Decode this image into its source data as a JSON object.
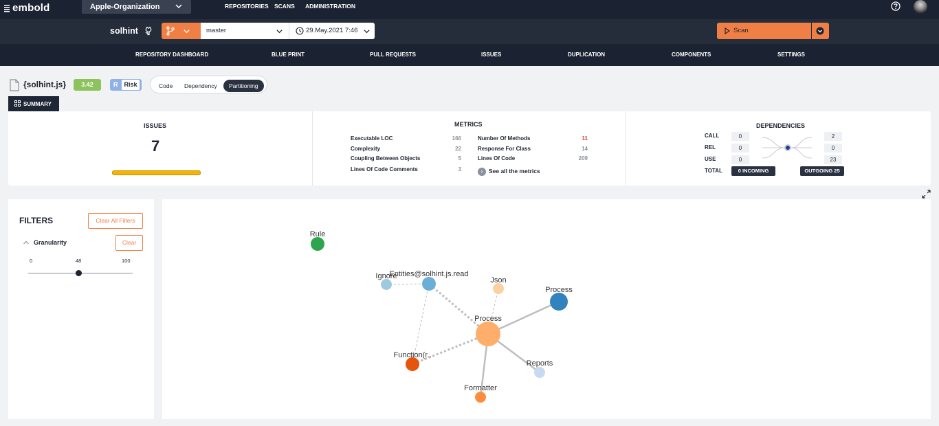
{
  "app": {
    "logo_text": "embold",
    "organization": "Apple-Organization",
    "nav": [
      "REPOSITORIES",
      "SCANS",
      "ADMINISTRATION"
    ]
  },
  "repo": {
    "name": "solhint",
    "branch": "master",
    "scan_date": "29.May.2021 7:46",
    "scan_label": "Scan"
  },
  "tabs": [
    "REPOSITORY DASHBOARD",
    "BLUE PRINT",
    "PULL REQUESTS",
    "ISSUES",
    "DUPLICATION",
    "COMPONENTS",
    "SETTINGS"
  ],
  "file": {
    "name": "{solhint.js}",
    "score": "3.42",
    "risk_letter": "R",
    "risk_label": "Risk",
    "views": [
      "Code",
      "Dependency",
      "Partitioning"
    ],
    "active_view": "Partitioning"
  },
  "summary_tab": "SUMMARY",
  "issues": {
    "title": "ISSUES",
    "count": "7"
  },
  "metrics": {
    "title": "METRICS",
    "left": [
      {
        "label": "Executable LOC",
        "value": "166"
      },
      {
        "label": "Complexity",
        "value": "22"
      },
      {
        "label": "Coupling Between Objects",
        "value": "5"
      },
      {
        "label": "Lines Of Code Comments",
        "value": "3"
      }
    ],
    "right": [
      {
        "label": "Number Of Methods",
        "value": "11",
        "color": "#e03a3a"
      },
      {
        "label": "Response For Class",
        "value": "14"
      },
      {
        "label": "Lines Of Code",
        "value": "209"
      }
    ],
    "see_all": "See all the metrics"
  },
  "dependencies": {
    "title": "DEPENDENCIES",
    "rows": [
      {
        "label": "CALL",
        "incoming": "0",
        "outgoing": "2"
      },
      {
        "label": "REL",
        "incoming": "0",
        "outgoing": "0"
      },
      {
        "label": "USE",
        "incoming": "0",
        "outgoing": "23"
      }
    ],
    "total_label": "TOTAL",
    "incoming_total": "0 INCOMING",
    "outgoing_total": "OUTGOING 25"
  },
  "filters": {
    "title": "FILTERS",
    "clear_all": "Clear All Filters",
    "granularity_label": "Granularity",
    "clear": "Clear",
    "slider": {
      "min": "0",
      "value": "48",
      "max": "100"
    }
  },
  "graph": {
    "nodes": [
      {
        "label": "Rule",
        "color": "#2ea44f"
      },
      {
        "label": "Ignore",
        "color": "#9ecae1"
      },
      {
        "label": "Entities@solhint.js.read",
        "color": "#6baed6"
      },
      {
        "label": "Json",
        "color": "#fdd0a2"
      },
      {
        "label": "Process",
        "color": "#3182bd"
      },
      {
        "label": "Process",
        "color": "#fdae6b"
      },
      {
        "label": "Function(r..",
        "color": "#e6550d"
      },
      {
        "label": "Reports",
        "color": "#c6dbef"
      },
      {
        "label": "Formatter",
        "color": "#fd8d3c"
      }
    ]
  }
}
